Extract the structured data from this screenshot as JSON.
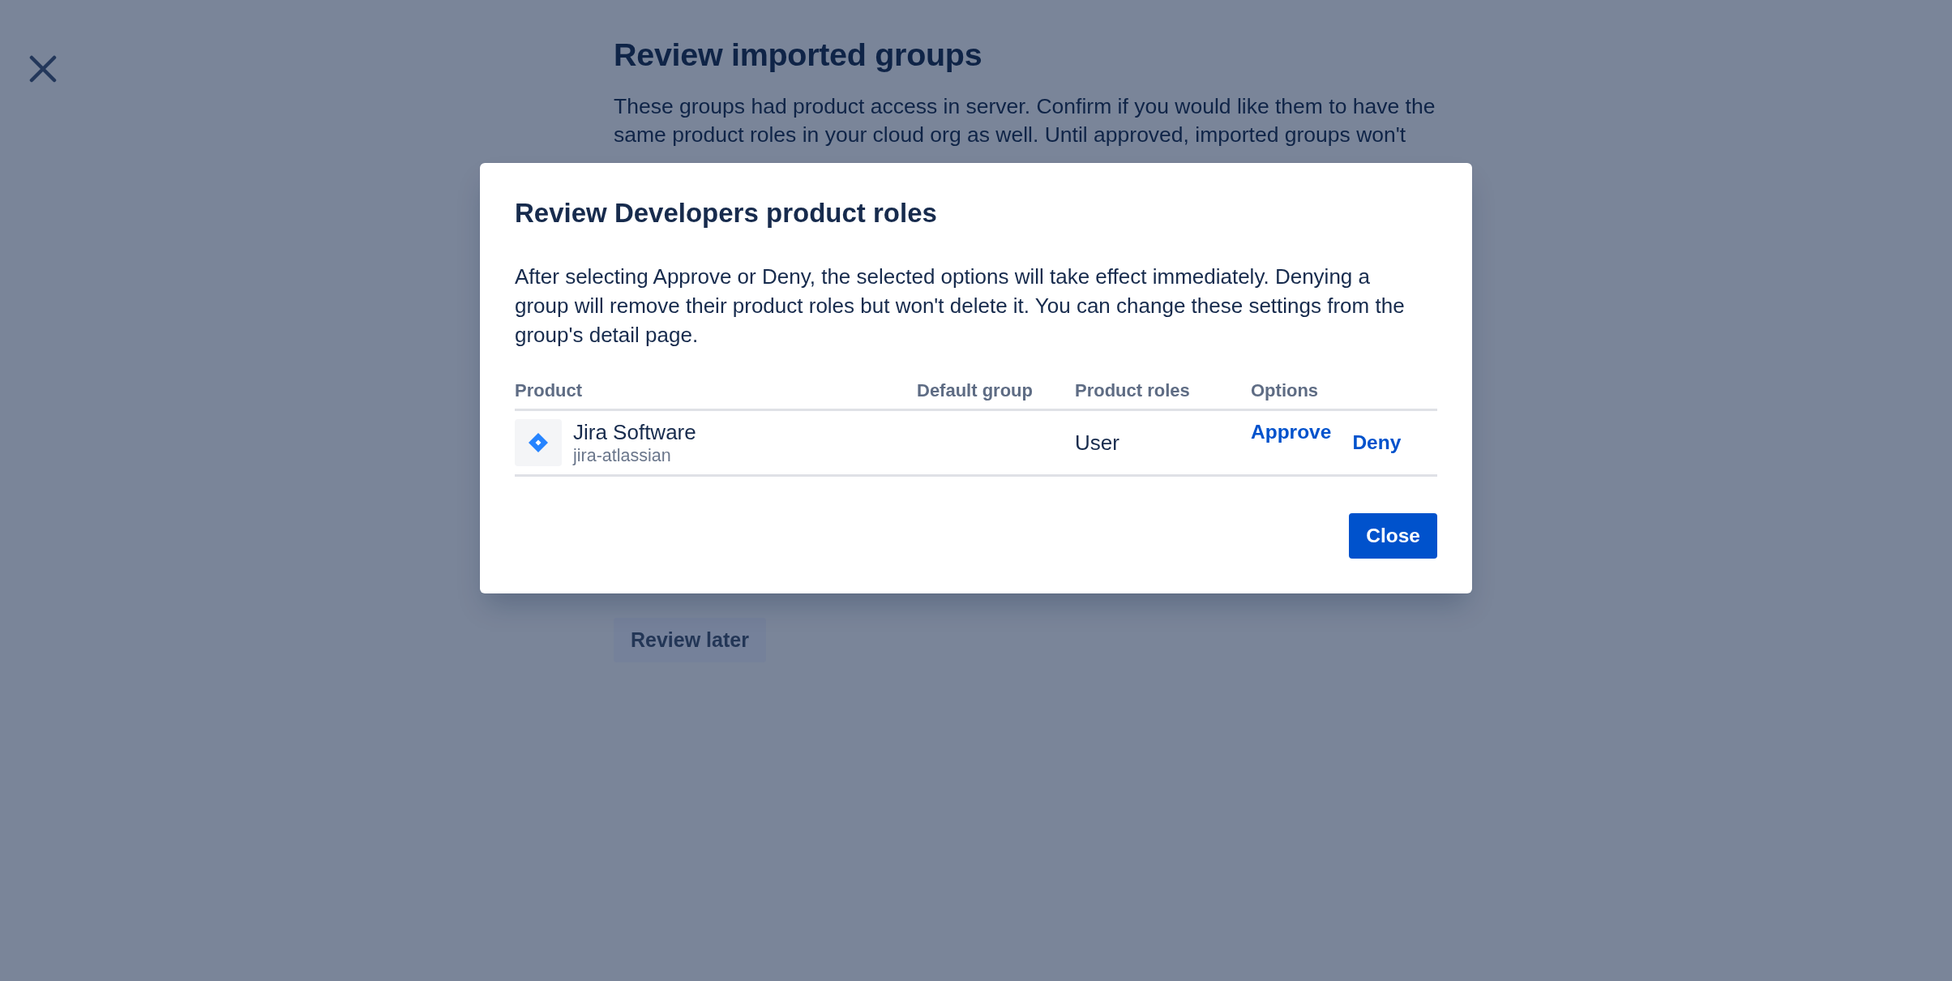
{
  "page": {
    "title": "Review imported groups",
    "description": "These groups had product access in server. Confirm if you would like them to have the same product roles in your cloud org as well. Until approved, imported groups won't",
    "secondary_button": "Review later"
  },
  "dialog": {
    "title": "Review Developers product roles",
    "description": "After selecting Approve or Deny, the selected options will take effect immediately. Denying a group will remove their product roles but won't delete it. You can change these settings from the group's detail page.",
    "table": {
      "columns": [
        "Product",
        "Default group",
        "Product roles",
        "Options"
      ],
      "rows": [
        {
          "product": {
            "name": "Jira Software",
            "key": "jira-atlassian"
          },
          "product_roles": "User",
          "options": [
            "Approve",
            "Deny"
          ]
        }
      ]
    },
    "buttons": [
      "Close"
    ]
  }
}
